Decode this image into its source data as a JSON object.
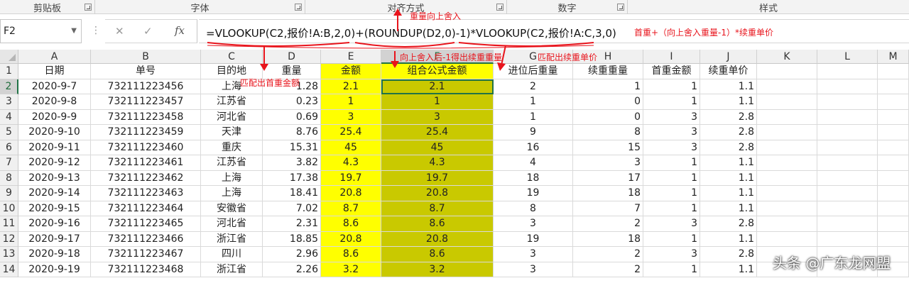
{
  "ribbon": {
    "groups": [
      {
        "label": "剪贴板"
      },
      {
        "label": "字体"
      },
      {
        "label": "对齐方式"
      },
      {
        "label": "数字"
      },
      {
        "label": "样式"
      }
    ]
  },
  "formula_bar": {
    "name_box": "F2",
    "formula": "=VLOOKUP(C2,报价!A:B,2,0)+(ROUNDUP(D2,0)-1)*VLOOKUP(C2,报价!A:C,3,0)",
    "cancel_icon": "close-icon",
    "enter_icon": "check-icon",
    "fx_label": "fx"
  },
  "annotations": {
    "roundup": "重量向上舍入",
    "summary": "首重+（向上舍入重量-1）*续重单价",
    "first_price": "匹配出首重金额",
    "cont_weight": "向上舍入后-1得出续重重量",
    "cont_price": "匹配出续重单价"
  },
  "columns": [
    "A",
    "B",
    "C",
    "D",
    "E",
    "F",
    "G",
    "H",
    "I",
    "J",
    "K",
    "L",
    "M"
  ],
  "selected_column": "F",
  "selected_row": "2",
  "table": {
    "headers": [
      "日期",
      "单号",
      "目的地",
      "重量",
      "金额",
      "组合公式金额",
      "进位后重量",
      "续重重量",
      "首重金额",
      "续重单价"
    ],
    "rows": [
      {
        "num": "2",
        "cells": [
          "2020-9-7",
          "732111223456",
          "上海",
          "1.28",
          "2.1",
          "2.1",
          "2",
          "1",
          "1",
          "1.1"
        ]
      },
      {
        "num": "3",
        "cells": [
          "2020-9-8",
          "732111223457",
          "江苏省",
          "0.23",
          "1",
          "1",
          "1",
          "0",
          "1",
          "1.1"
        ]
      },
      {
        "num": "4",
        "cells": [
          "2020-9-9",
          "732111223458",
          "河北省",
          "0.69",
          "3",
          "3",
          "1",
          "0",
          "3",
          "2.8"
        ]
      },
      {
        "num": "5",
        "cells": [
          "2020-9-10",
          "732111223459",
          "天津",
          "8.76",
          "25.4",
          "25.4",
          "9",
          "8",
          "3",
          "2.8"
        ]
      },
      {
        "num": "6",
        "cells": [
          "2020-9-11",
          "732111223460",
          "重庆",
          "15.31",
          "45",
          "45",
          "16",
          "15",
          "3",
          "2.8"
        ]
      },
      {
        "num": "7",
        "cells": [
          "2020-9-12",
          "732111223461",
          "江苏省",
          "3.82",
          "4.3",
          "4.3",
          "4",
          "3",
          "1",
          "1.1"
        ]
      },
      {
        "num": "8",
        "cells": [
          "2020-9-13",
          "732111223462",
          "上海",
          "17.38",
          "19.7",
          "19.7",
          "18",
          "17",
          "1",
          "1.1"
        ]
      },
      {
        "num": "9",
        "cells": [
          "2020-9-14",
          "732111223463",
          "上海",
          "18.41",
          "20.8",
          "20.8",
          "19",
          "18",
          "1",
          "1.1"
        ]
      },
      {
        "num": "10",
        "cells": [
          "2020-9-15",
          "732111223464",
          "安徽省",
          "7.02",
          "8.7",
          "8.7",
          "8",
          "7",
          "1",
          "1.1"
        ]
      },
      {
        "num": "11",
        "cells": [
          "2020-9-16",
          "732111223465",
          "河北省",
          "2.31",
          "8.6",
          "8.6",
          "3",
          "2",
          "3",
          "2.8"
        ]
      },
      {
        "num": "12",
        "cells": [
          "2020-9-17",
          "732111223466",
          "浙江省",
          "18.85",
          "20.8",
          "20.8",
          "19",
          "18",
          "1",
          "1.1"
        ]
      },
      {
        "num": "13",
        "cells": [
          "2020-9-18",
          "732111223467",
          "四川",
          "2.96",
          "8.6",
          "8.6",
          "3",
          "2",
          "3",
          "2.8"
        ]
      },
      {
        "num": "14",
        "cells": [
          "2020-9-19",
          "732111223468",
          "浙江省",
          "2.26",
          "3.2",
          "3.2",
          "3",
          "2",
          "1",
          "1.1"
        ]
      }
    ]
  },
  "watermark": "头条 @广东龙网盟",
  "colors": {
    "amount_fill": "#ffff00",
    "combined_fill": "#c9c900",
    "annotation": "#e8141c",
    "selection": "#217346"
  }
}
